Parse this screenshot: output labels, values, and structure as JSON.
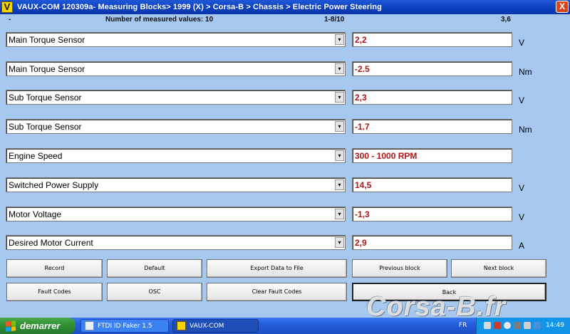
{
  "window": {
    "logo_letter": "V",
    "title": "VAUX-COM 120309a- Measuring Blocks> 1999 (X) > Corsa-B > Chassis > Electric Power Steering",
    "close_label": "X"
  },
  "info": {
    "dash": "-",
    "measured_count": "Number of measured values: 10",
    "page": "1-8/10",
    "value": "3,6"
  },
  "rows": [
    {
      "label": "Main Torque Sensor",
      "value": "2,2",
      "unit": "V"
    },
    {
      "label": "Main Torque Sensor",
      "value": "-2.5",
      "unit": "Nm"
    },
    {
      "label": "Sub Torque Sensor",
      "value": "2,3",
      "unit": "V"
    },
    {
      "label": "Sub Torque Sensor",
      "value": "-1.7",
      "unit": "Nm"
    },
    {
      "label": "Engine Speed",
      "value": "300 - 1000 RPM",
      "unit": ""
    },
    {
      "label": "Switched Power Supply",
      "value": "14,5",
      "unit": "V"
    },
    {
      "label": "Motor Voltage",
      "value": "-1,3",
      "unit": "V"
    },
    {
      "label": "Desired Motor Current",
      "value": "2,9",
      "unit": "A"
    }
  ],
  "dropdown_arrow": "▾",
  "buttons": {
    "record": "Record",
    "default": "Default",
    "export": "Export Data to File",
    "previous_block": "Previous block",
    "next_block": "Next block",
    "fault_codes": "Fault Codes",
    "osc": "OSC",
    "clear_fault_codes": "Clear Fault Codes",
    "back": "Back"
  },
  "taskbar": {
    "start_label": "demarrer",
    "tasks": [
      {
        "label": "FTDI ID Faker 1.5",
        "icon": "window-icon",
        "active": false
      },
      {
        "label": "VAUX-COM",
        "icon": "vauxcom-icon",
        "active": true
      }
    ],
    "language": "FR",
    "clock": "14:49"
  },
  "watermark": "Corsa-B.fr",
  "colors": {
    "background": "#a6c8ef",
    "value_text": "#b01616",
    "titlebar": "#0b3fbe",
    "taskbar": "#245edb",
    "start": "#2f8d33"
  }
}
